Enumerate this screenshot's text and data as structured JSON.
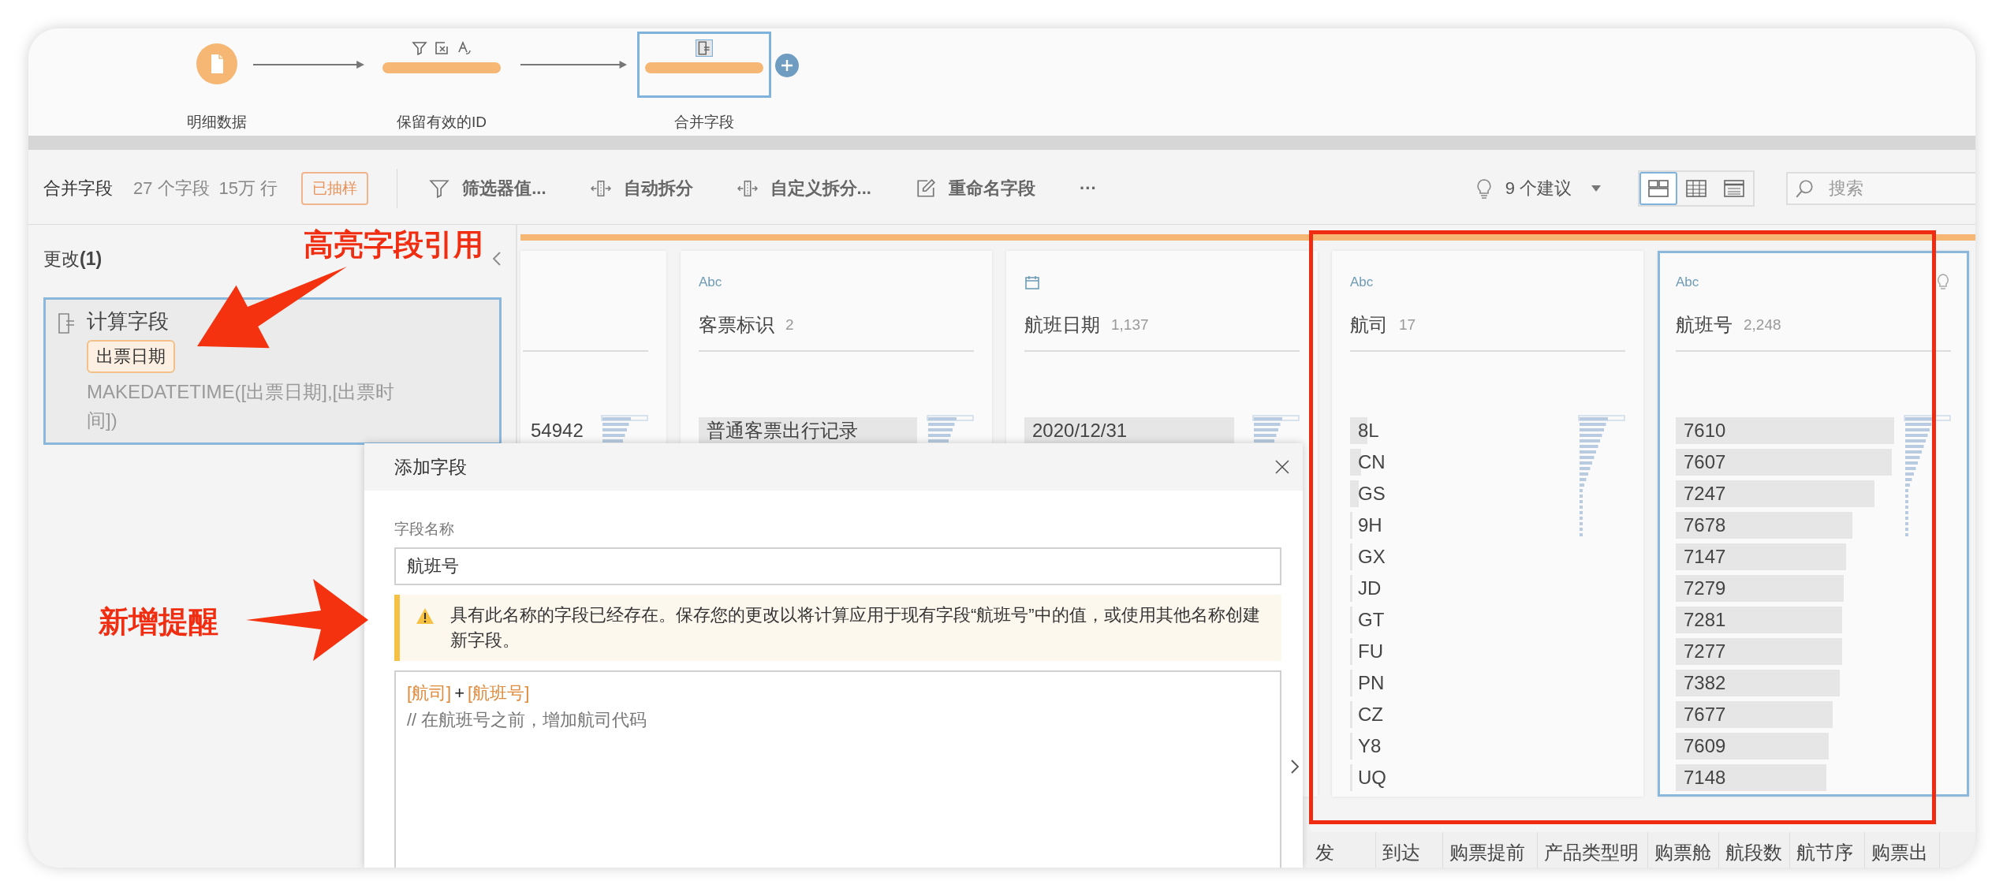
{
  "flow": {
    "nodes": [
      {
        "kind": "input",
        "label": "明细数据",
        "selected": false
      },
      {
        "kind": "clean",
        "label": "保留有效的ID",
        "selected": false,
        "change_icons": [
          {
            "kind": "filter"
          },
          {
            "kind": "remove-field"
          },
          {
            "kind": "rename"
          }
        ]
      },
      {
        "kind": "clean",
        "label": "合并字段",
        "selected": true,
        "change_icons": [
          {
            "kind": "calculation"
          }
        ]
      }
    ]
  },
  "toolbar": {
    "step_name": "合并字段",
    "field_count": "27 个字段",
    "row_count": "15万 行",
    "sample_badge": "已抽样",
    "actions": [
      {
        "kind": "filter",
        "label": "筛选器值..."
      },
      {
        "kind": "auto-split",
        "label": "自动拆分"
      },
      {
        "kind": "custom-split",
        "label": "自定义拆分..."
      },
      {
        "kind": "rename",
        "label": "重命名字段"
      },
      {
        "kind": "more",
        "label": "···"
      }
    ],
    "suggestions": "9 个建议",
    "views": [
      {
        "kind": "profile",
        "selected": true
      },
      {
        "kind": "table",
        "selected": false
      },
      {
        "kind": "list",
        "selected": false
      }
    ],
    "search": {
      "placeholder": "搜索"
    }
  },
  "changes_panel": {
    "title": "更改**(1)**",
    "changes": [
      {
        "kind": "calculation",
        "title": "计算字段",
        "field_tag": "出票日期",
        "formula": "MAKEDATETIME([出票日期],[出票时间])",
        "selected": true
      }
    ]
  },
  "profile_cards": [
    {
      "kind": "partial",
      "selected": false,
      "has_suggestion": false,
      "values": [
        {
          "text": "54942"
        }
      ]
    },
    {
      "kind": "string",
      "type_label": "Abc",
      "title": "客票标识",
      "count": "2",
      "selected": false,
      "has_suggestion": false,
      "values": [
        {
          "text": "普通客票出行记录",
          "level": 1.0
        }
      ]
    },
    {
      "kind": "date",
      "title": "航班日期",
      "count": "1,137",
      "selected": false,
      "has_suggestion": false,
      "values": [
        {
          "text": "2020/12/31",
          "level": 0.96
        }
      ]
    },
    {
      "kind": "string",
      "type_label": "Abc",
      "title": "航司",
      "count": "17",
      "selected": false,
      "has_suggestion": false,
      "values": [
        {
          "text": "8L",
          "level": 0.08
        },
        {
          "text": "CN",
          "level": 0.05
        },
        {
          "text": "GS",
          "level": 0.04
        },
        {
          "text": "9H",
          "level": 0.01
        },
        {
          "text": "GX",
          "level": 0.01
        },
        {
          "text": "JD",
          "level": 0.01
        },
        {
          "text": "GT",
          "level": 0.01
        },
        {
          "text": "FU",
          "level": 0.01
        },
        {
          "text": "PN",
          "level": 0.01
        },
        {
          "text": "CZ",
          "level": 0.01
        },
        {
          "text": "Y8",
          "level": 0.01
        },
        {
          "text": "UQ",
          "level": 0.01
        }
      ]
    },
    {
      "kind": "string",
      "type_label": "Abc",
      "title": "航班号",
      "count": "2,248",
      "selected": true,
      "has_suggestion": true,
      "values": [
        {
          "text": "7610",
          "level": 1.0
        },
        {
          "text": "7607",
          "level": 0.99
        },
        {
          "text": "7247",
          "level": 0.91
        },
        {
          "text": "7678",
          "level": 0.81
        },
        {
          "text": "7147",
          "level": 0.78
        },
        {
          "text": "7279",
          "level": 0.77
        },
        {
          "text": "7281",
          "level": 0.76
        },
        {
          "text": "7277",
          "level": 0.76
        },
        {
          "text": "7382",
          "level": 0.75
        },
        {
          "text": "7677",
          "level": 0.72
        },
        {
          "text": "7609",
          "level": 0.7
        },
        {
          "text": "7148",
          "level": 0.69
        }
      ]
    }
  ],
  "column_headers": [
    "发",
    "到达",
    "购票提前",
    "产品类型明",
    "购票舱",
    "航段数",
    "航节序",
    "购票出"
  ],
  "dialog": {
    "title": "添加字段",
    "name_label": "字段名称",
    "name_value": "航班号",
    "warning": "具有此名称的字段已经存在。保存您的更改以将计算应用于现有字段“航班号”中的值，或使用其他名称创建新字段。",
    "code_lines": [
      [
        {
          "kind": "field",
          "text": "[航司]"
        },
        {
          "kind": "operator",
          "text": "+"
        },
        {
          "kind": "field",
          "text": "[航班号]"
        }
      ],
      [
        {
          "kind": "comment",
          "text": "// 在航班号之前，增加航司代码"
        }
      ]
    ]
  },
  "annotations": [
    {
      "kind": "callout",
      "text": "高亮字段引用"
    },
    {
      "kind": "callout",
      "text": "新增提醒"
    }
  ]
}
